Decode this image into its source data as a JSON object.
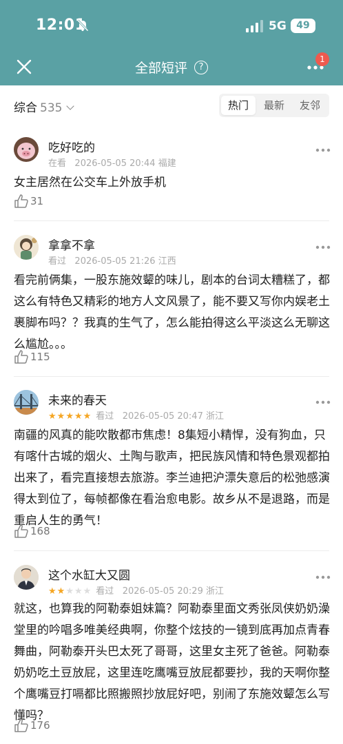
{
  "status_bar": {
    "time": "12:01",
    "network": "5G",
    "battery": "49"
  },
  "nav": {
    "title": "全部短评",
    "help_glyph": "?",
    "notification_count": "1"
  },
  "filter": {
    "sort_label": "综合",
    "count": "535",
    "tabs": [
      {
        "label": "热门",
        "active": true
      },
      {
        "label": "最新",
        "active": false
      },
      {
        "label": "友邻",
        "active": false
      }
    ]
  },
  "reviews": [
    {
      "username": "吃好吃的",
      "status": "在看",
      "rating_stars": null,
      "datetime": "2026-05-05 20:44",
      "location": "福建",
      "text": "女主居然在公交车上外放手机",
      "likes": "31"
    },
    {
      "username": "拿拿不拿",
      "status": "看过",
      "rating_stars": null,
      "datetime": "2026-05-05 21:26",
      "location": "江西",
      "text": "看完前俩集，一股东施效颦的味儿，剧本的台词太糟糕了，都这么有特色又精彩的地方人文风景了，能不要又写你内娱老土裹脚布吗？？我真的生气了，怎么能拍得这么平淡这么无聊这么尴尬。。。",
      "likes": "115"
    },
    {
      "username": "未来的春天",
      "status": "看过",
      "rating_stars": 5,
      "datetime": "2026-05-05 20:47",
      "location": "浙江",
      "text": "南疆的风真的能吹散都市焦虑！8集短小精悍，没有狗血，只有喀什古城的烟火、土陶与歌声，把民族风情和特色景观都拍出来了，看完直接想去旅游。李兰迪把沪漂失意后的松弛感演得太到位了，每帧都像在看治愈电影。故乡从不是退路，而是重启人生的勇气！",
      "likes": "168"
    },
    {
      "username": "这个水缸大又圆",
      "status": "看过",
      "rating_stars": 2,
      "datetime": "2026-05-05 20:29",
      "location": "浙江",
      "text": "就这，也算我的阿勒泰姐妹篇？阿勒泰里面文秀张凤侠奶奶澡堂里的吟唱多唯美经典啊，你整个炫技的一镜到底再加点青春舞曲，阿勒泰开头巴太死了哥哥，这里女主死了爸爸。阿勒泰奶奶吃土豆放屁，这里连吃鹰嘴豆放屁都要抄，我的天啊你整个鹰嘴豆打嗝都比照搬照抄放屁好吧，别闹了东施效颦怎么写懂吗？",
      "likes": "176"
    }
  ],
  "colors": {
    "header_bg": "#5aa1a4",
    "star_on": "#f5a623",
    "star_off": "#dddddd",
    "badge": "#ee5a4f"
  }
}
